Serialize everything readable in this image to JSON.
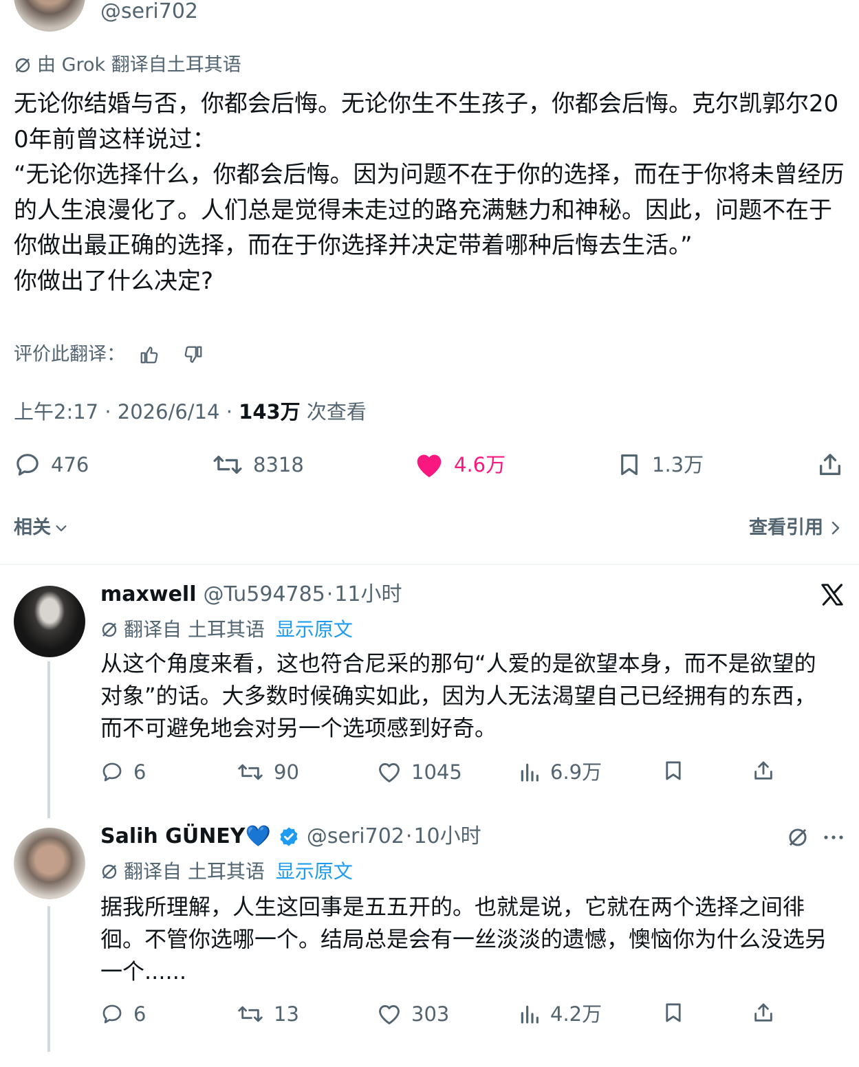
{
  "main_tweet": {
    "handle": "@seri702",
    "translated_by": "由 Grok 翻译自土耳其语",
    "text": "无论你结婚与否，你都会后悔。无论你生不生孩子，你都会后悔。克尔凯郭尔200年前曾这样说过：\n“无论你选择什么，你都会后悔。因为问题不在于你的选择，而在于你将未曾经历的人生浪漫化了。人们总是觉得未走过的路充满魅力和神秘。因此，问题不在于你做出最正确的选择，而在于你选择并决定带着哪种后悔去生活。”\n你做出了什么决定?",
    "rate_label": "评价此翻译：",
    "time": "上午2:17",
    "sep1": "·",
    "date": "2026/6/14",
    "sep2": "·",
    "views_count": "143万",
    "views_label": " 次查看",
    "actions": {
      "replies": "476",
      "retweets": "8318",
      "likes": "4.6万",
      "bookmarks": "1.3万"
    },
    "like_color": "#f91880",
    "related_label": "相关",
    "quotes_label": "查看引用"
  },
  "replies": [
    {
      "name": "maxwell",
      "handle": "@Tu594785",
      "sep": "·",
      "time": "11小时",
      "translated_from": "翻译自 土耳其语",
      "show_original": "显示原文",
      "text": "从这个角度来看，这也符合尼采的那句“人爱的是欲望本身，而不是欲望的对象”的话。大多数时候确实如此，因为人无法渴望自己已经拥有的东西，而不可避免地会对另一个选项感到好奇。",
      "replies": "6",
      "retweets": "90",
      "likes": "1045",
      "views": "6.9万"
    },
    {
      "name": "Salih GÜNEY",
      "emoji": "💙",
      "handle": "@seri702",
      "sep": "·",
      "time": "10小时",
      "translated_from": "翻译自 土耳其语",
      "show_original": "显示原文",
      "text": "据我所理解，人生这回事是五五开的。也就是说，它就在两个选择之间徘徊。不管你选哪一个。结局总是会有一丝淡淡的遗憾，懊恼你为什么没选另一个......",
      "replies": "6",
      "retweets": "13",
      "likes": "303",
      "views": "4.2万"
    }
  ]
}
